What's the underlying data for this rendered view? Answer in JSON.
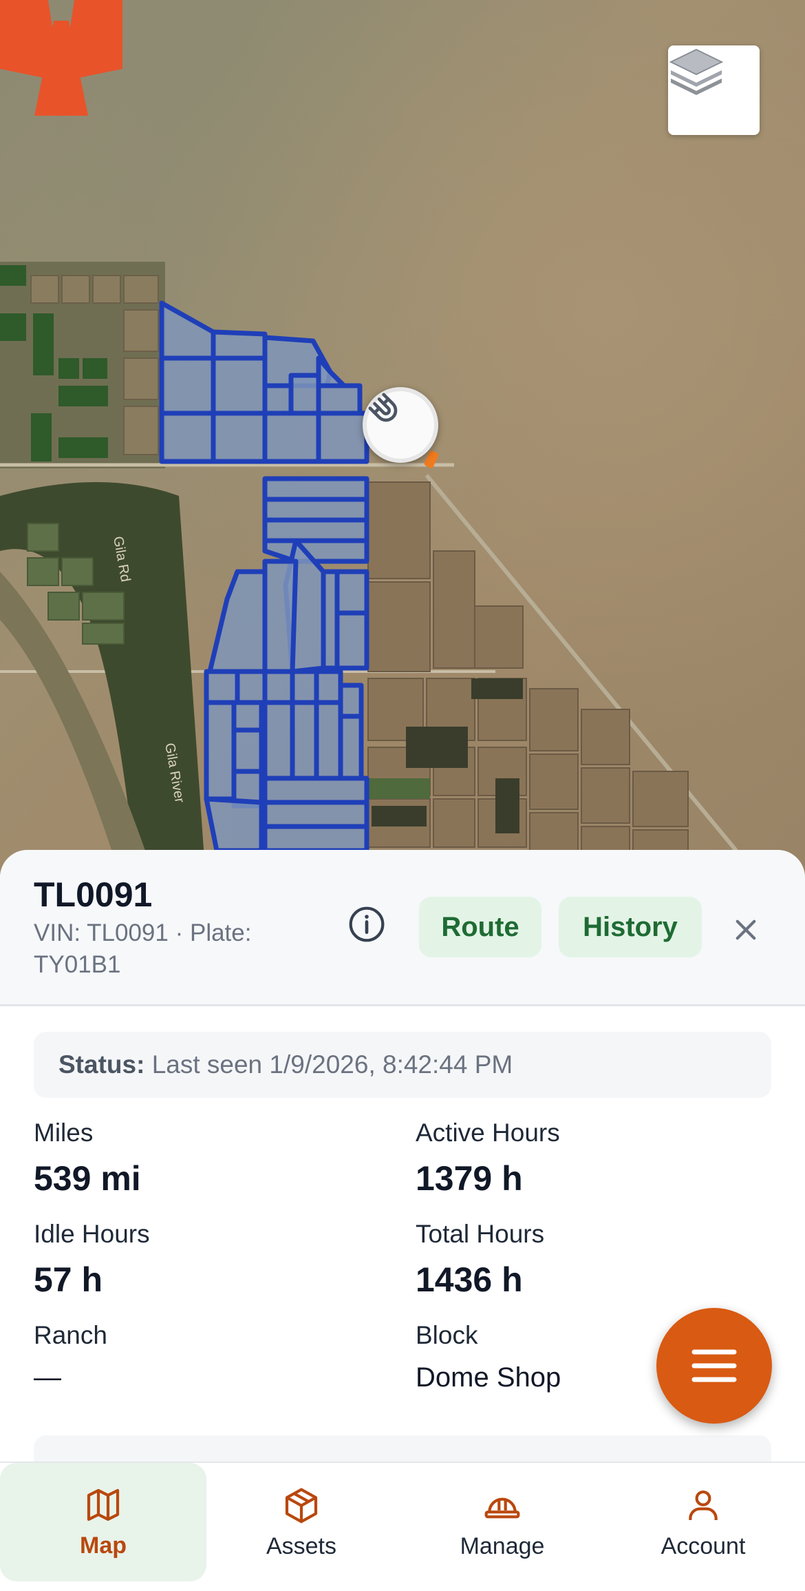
{
  "map": {
    "road_label_1": "Gila Rd",
    "road_label_2": "Gila River"
  },
  "vehicle": {
    "id": "TL0091",
    "subtitle": "VIN: TL0091 · Plate: TY01B1"
  },
  "actions": {
    "route": "Route",
    "history": "History"
  },
  "status": {
    "label": "Status:",
    "value": "Last seen 1/9/2026, 8:42:44 PM"
  },
  "stats": {
    "miles_label": "Miles",
    "miles_value": "539 mi",
    "active_label": "Active Hours",
    "active_value": "1379 h",
    "idle_label": "Idle Hours",
    "idle_value": "57 h",
    "total_label": "Total Hours",
    "total_value": "1436 h",
    "ranch_label": "Ranch",
    "ranch_value": "—",
    "block_label": "Block",
    "block_value": "Dome Shop"
  },
  "nav": {
    "items": [
      {
        "label": "Map",
        "icon": "map-icon"
      },
      {
        "label": "Assets",
        "icon": "box-icon"
      },
      {
        "label": "Manage",
        "icon": "hardhat-icon"
      },
      {
        "label": "Account",
        "icon": "user-icon"
      }
    ]
  },
  "colors": {
    "accent": "#d95a12",
    "field_outline": "#1f3fb8",
    "pill_bg": "#e3f4e6",
    "pill_text": "#1f6b34"
  }
}
